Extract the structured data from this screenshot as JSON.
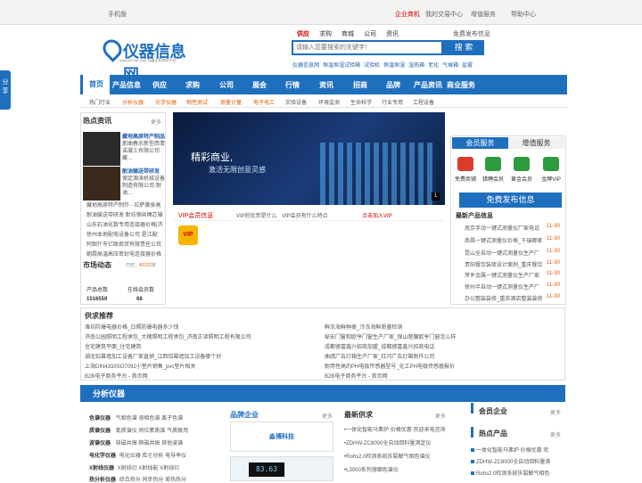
{
  "topbar": {
    "mobile": "手机版",
    "enterprise": "企业商机",
    "trade_center": "我的交易中心",
    "value_added": "增值服务",
    "help_center": "帮助中心"
  },
  "logo": {
    "name": "仪器信息网",
    "url": "www.51Y5K.com 仪器企业商机平台"
  },
  "search": {
    "tabs": [
      "供应",
      "求购",
      "商城",
      "公司",
      "资讯"
    ],
    "placeholder": "请输入您要搜索的关键字！",
    "button": "搜 索",
    "free_publish": "免费发布信息",
    "hot_words": [
      "仪器信息网",
      "恒温恒湿试验箱",
      "试验机",
      "恒温恒湿",
      "湿热箱",
      "老化",
      "气候箱",
      "盐雾"
    ]
  },
  "nav": {
    "items": [
      "首页",
      "产品信息",
      "供应",
      "求购",
      "公司",
      "展会",
      "行情",
      "资讯",
      "招商",
      "品牌",
      "产品资讯",
      "商业服务"
    ]
  },
  "subnav": {
    "items": [
      "热门行业",
      "分析仪器",
      "光学仪器",
      "物性测试",
      "测量计量",
      "电子电工",
      "实验设备",
      "环境监测",
      "生命科学",
      "行业专用",
      "工程设备"
    ]
  },
  "side_tab": {
    "label": "分享"
  },
  "hot_news": {
    "title": "热点资讯",
    "more": "更多",
    "ad1": "藏地高原特产制品",
    "ad1_desc": "那曲春忠新型西青诺凝土有限公司·藏…",
    "ad2": "耐油输送带研发",
    "ad2_desc": "保定源涛机械设备制造有限公司·耐油…",
    "items": [
      "藏地高原特产制作 - 拉萨黄食高",
      "耐油输送带研发 耐坊钢丝绳芯输",
      "山东石油化数专用连接器价格|济",
      "徐州本地配电设备公司 是江配",
      "阿图什市亿联商贸有限责任公司",
      "朝霞高温高压密封电连接器价格"
    ]
  },
  "market": {
    "title": "市场动态",
    "visits_label": "已旺：",
    "visits": "40122",
    "unit": "家",
    "products_label": "产品总数",
    "products_value": "1516559",
    "members_label": "在线会员数",
    "members_value": "68"
  },
  "banner": {
    "line1": "精彩商业,",
    "line2": "激活无限创意灵感",
    "page": "1"
  },
  "vip": {
    "title": "VIP会员信息",
    "link1": "VIP的优势是什么",
    "link2": "VIP会员有什么特点",
    "join": "点击加入VIP",
    "badge": "VIP"
  },
  "services": {
    "tab1": "会员服务",
    "tab2": "增值服务",
    "icons": [
      "免费商铺",
      "猎聘会员",
      "黄金会员",
      "金牌VIP"
    ],
    "publish": "免费发布信息",
    "latest_title": "最新产品信息",
    "latest": [
      {
        "t": "南京手动一键式测量仪厂家电话",
        "d": "11-30"
      },
      {
        "t": "南昌一键式测量仪价格_千瑞卿家",
        "d": "11-30"
      },
      {
        "t": "昆山全自动一键式测量仪生产厂",
        "d": "11-30"
      },
      {
        "t": "贵阳餐饮装修设计案例_重庆餐饮",
        "d": "11-30"
      },
      {
        "t": "萍乡金属一键式测量仪生产厂家",
        "d": "11-30"
      },
      {
        "t": "徐州半自动一键式测量仪生产厂",
        "d": "11-30"
      },
      {
        "t": "办公整装装修_重庆酒店整装装修",
        "d": "11-30"
      }
    ]
  },
  "demand": {
    "title": "供求推荐",
    "left": [
      "潍坊防爆电器价格_日照防爆电器多少钱",
      "济南公园照明工程承包_大槐照明工程承包_济南正读照明工程有限公司",
      "住宅建筑平面_住宅建筑",
      "湖北铝幕墙加工设备厂家直销_江西铝幕墙加工设备哪个好",
      "上海DIN433/ISO7092小垫片销售_pvc垫片相关",
      "B2B电子商务平台 - 首页网"
    ],
    "right": [
      "鲜冻海鲜种类_冷冻海鲜质量检测",
      "秘安门窗和欧亨门窗生产厂家_保山楚腺欧亨门窗怎么样",
      "成都德富鑫兴招商加盟_成都德富鑫兴招商电话",
      "曲靖广告灯箱生产厂家_红河广告灯箱制作公司",
      "耐用性高的PH电极传感器型号_化工PH电极传感器报价",
      "B2B电子商务平台 - 首页网"
    ]
  },
  "analyze": {
    "title": "分析仪器",
    "rows": [
      {
        "h": "色谱仪器",
        "i": [
          "气相色谱",
          "液相色谱",
          "离子色谱"
        ]
      },
      {
        "h": "质谱仪器",
        "i": [
          "氦质谱仪",
          "同位素质谱",
          "气质联用"
        ]
      },
      {
        "h": "波谱仪器",
        "i": [
          "核磁共振",
          "顺磁共振",
          "其他波谱"
        ]
      },
      {
        "h": "电化学仪器",
        "i": [
          "电化仪器",
          "库仑分析",
          "电导率仪"
        ]
      },
      {
        "h": "X射线仪器",
        "i": [
          "X射线衍",
          "X射线能",
          "X射线衍"
        ]
      },
      {
        "h": "热分析仪器",
        "i": [
          "综合热分",
          "同步热分",
          "差热热分"
        ]
      }
    ],
    "brand_title": "品牌企业",
    "brand_more": "更多",
    "brand_logo": "淼博科技",
    "meter_value": "83.63",
    "supply_title": "最新供求",
    "supply_more": "更多",
    "supply": [
      "一体化智能马弗炉 价格优惠 欢迎来电咨询",
      "ZDHW-ZC8000全自动回料量测定仪",
      "Rohs2.0检测系统拆裂解气相色谱仪",
      "L3000系列溶细色谱仪"
    ],
    "member_title": "会员企业",
    "member_more": "更多",
    "hot_title": "热点产品",
    "hot_more": "更多",
    "hot": [
      "一体化智能马弗炉 价格优惠 欢",
      "ZDHW-ZC8000全自动回料量测",
      "Rohs2.0检测系统拆裂解气相色"
    ]
  },
  "colors": {
    "brand": "#1f6fbf",
    "accent": "#e55a00",
    "alert": "#c00000"
  }
}
